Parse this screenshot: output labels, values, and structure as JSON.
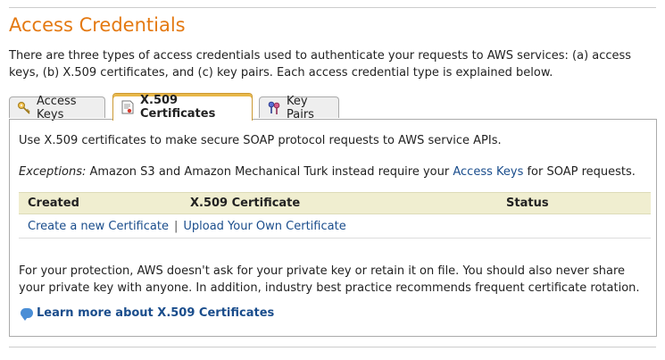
{
  "page": {
    "title": "Access Credentials",
    "intro": "There are three types of access credentials used to authenticate your requests to AWS services: (a) access keys, (b) X.509 certificates, and (c) key pairs. Each access credential type is explained below."
  },
  "tabs": [
    {
      "label": "Access Keys",
      "icon": "key-icon",
      "active": false
    },
    {
      "label": "X.509 Certificates",
      "icon": "certificate-icon",
      "active": true
    },
    {
      "label": "Key Pairs",
      "icon": "key-pair-icon",
      "active": false
    }
  ],
  "panel": {
    "description": "Use X.509 certificates to make secure SOAP protocol requests to AWS service APIs.",
    "exceptions_label": "Exceptions:",
    "exceptions_pre": " Amazon S3 and Amazon Mechanical Turk instead require your ",
    "exceptions_link": "Access Keys",
    "exceptions_post": " for SOAP requests.",
    "table": {
      "columns": [
        "Created",
        "X.509 Certificate",
        "Status"
      ]
    },
    "create_link": "Create a new Certificate",
    "separator": "|",
    "upload_link": "Upload Your Own Certificate",
    "protection_note": "For your protection, AWS doesn't ask for your private key or retain it on file. You should also never share your private key with anyone. In addition, industry best practice recommends frequent certificate rotation.",
    "learn_more": "Learn more about X.509 Certificates"
  },
  "colors": {
    "title": "#e47911",
    "link": "#1a4d8c",
    "table_header_bg": "#f0eed0"
  }
}
